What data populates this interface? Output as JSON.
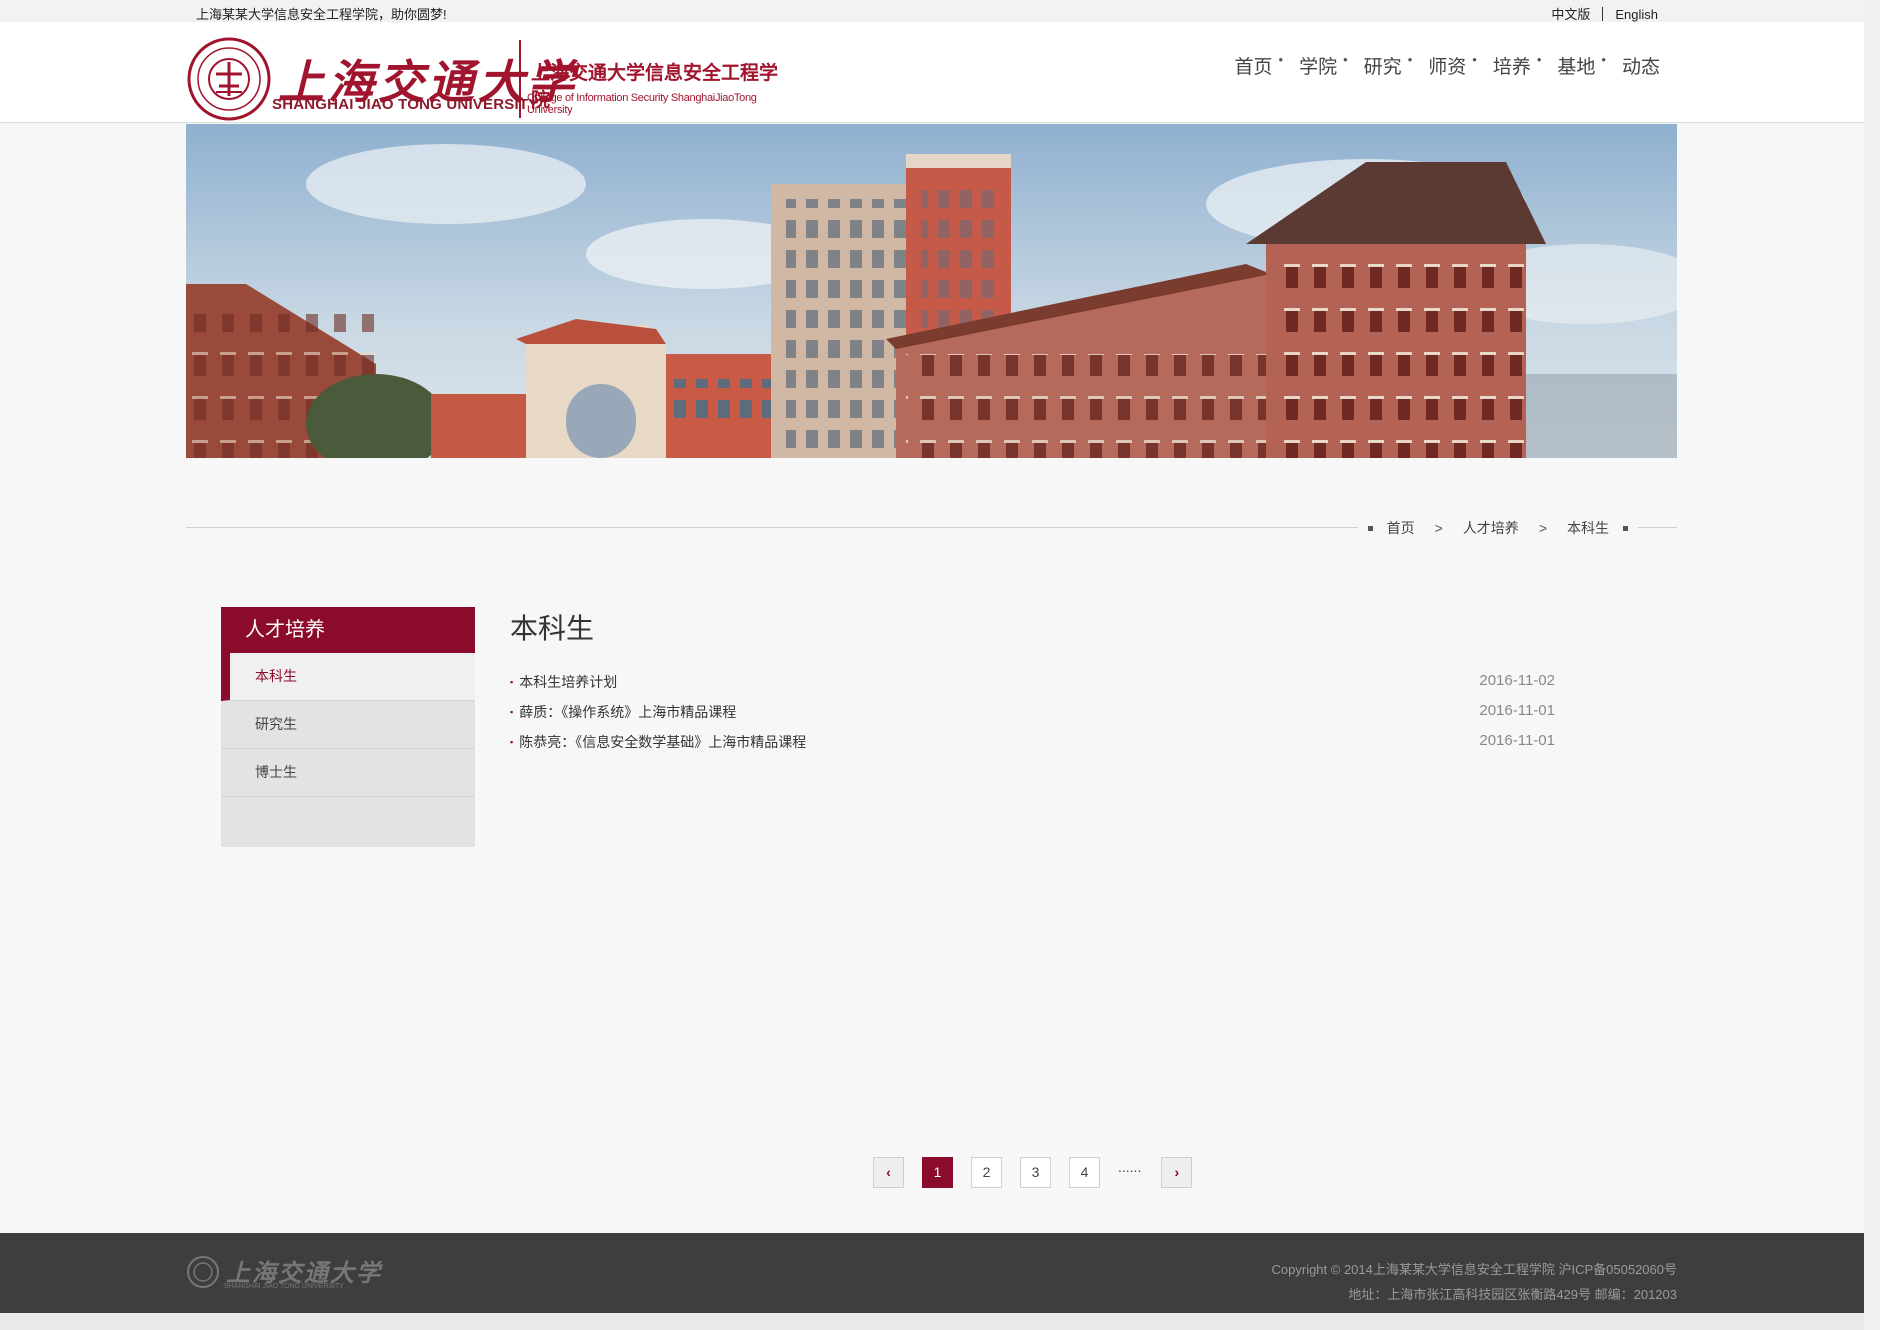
{
  "topbar": {
    "welcome": "上海某某大学信息安全工程学院，助你圆梦!",
    "lang_cn": "中文版",
    "lang_en": "English"
  },
  "header": {
    "logo_cn": "上海交通大学",
    "logo_en": "SHANGHAI JIAO TONG UNIVERSITY",
    "college_cn": "上海交通大学信息安全工程学院",
    "college_en": "College of Information Security ShanghaiJiaoTong University",
    "nav": [
      "首页",
      "学院",
      "研究",
      "师资",
      "培养",
      "基地",
      "动态"
    ],
    "nav_dot": "•"
  },
  "breadcrumb": {
    "home": "首页",
    "sep": ">",
    "section": "人才培养",
    "current": "本科生"
  },
  "sidebar": {
    "title": "人才培养",
    "items": [
      {
        "label": "本科生",
        "active": true
      },
      {
        "label": "研究生",
        "active": false
      },
      {
        "label": "博士生",
        "active": false
      }
    ]
  },
  "content": {
    "title": "本科生",
    "news": [
      {
        "title": "本科生培养计划",
        "date": "2016-11-02"
      },
      {
        "title": "薛质：《操作系统》上海市精品课程",
        "date": "2016-11-01"
      },
      {
        "title": "陈恭亮：《信息安全数学基础》上海市精品课程",
        "date": "2016-11-01"
      }
    ]
  },
  "pager": {
    "prev": "‹",
    "pages": [
      "1",
      "2",
      "3",
      "4"
    ],
    "dots": "......",
    "next": "›",
    "current": "1"
  },
  "footer": {
    "logo_cn": "上海交通大学",
    "logo_en": "SHANGHAI JIAO TONG UNIVERSITY",
    "copyright": "Copyright © 2014上海某某大学信息安全工程学院 沪ICP备05052060号",
    "address": "地址：上海市张江高科技园区张衡路429号 邮编：201203"
  },
  "colors": {
    "brand": "#8b0b2c",
    "footer_bg": "#3e3e3e"
  }
}
